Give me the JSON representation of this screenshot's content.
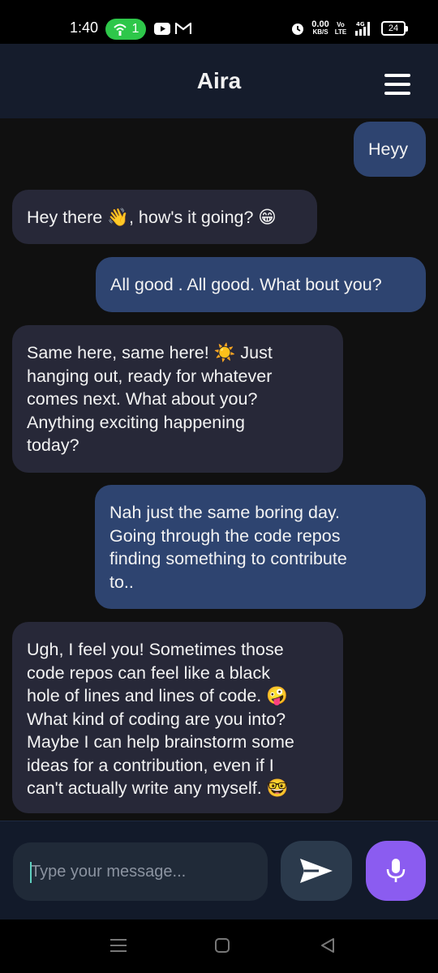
{
  "status_bar": {
    "time": "1:40",
    "hotspot_count": "1",
    "net_speed": "0.00",
    "net_speed_unit": "KB/S",
    "volte_top": "Vo",
    "volte_bottom": "LTE",
    "network_type": "4G",
    "battery": "24",
    "icons": [
      "hotspot-icon",
      "youtube-icon",
      "gmail-icon",
      "alarm-icon",
      "signal-icon",
      "battery-icon"
    ]
  },
  "header": {
    "title": "Aira",
    "menu_icon": "hamburger-menu-icon"
  },
  "messages": [
    {
      "sender": "user",
      "text": "Heyy"
    },
    {
      "sender": "bot",
      "text": "Hey there 👋, how's it going? 😁"
    },
    {
      "sender": "user",
      "text": "All good . All good. What bout you?"
    },
    {
      "sender": "bot",
      "text": "Same here, same here! ☀️ Just\nhanging out, ready for whatever\ncomes next. What about you?\nAnything exciting happening\ntoday?"
    },
    {
      "sender": "user",
      "text": "Nah just the same boring day.\nGoing through the code repos\nfinding something to contribute\nto.."
    },
    {
      "sender": "bot",
      "text": "Ugh, I feel you! Sometimes those\ncode repos can feel like a black\nhole of lines and lines of code. 🤪\nWhat kind of coding are you into?\nMaybe I can help brainstorm some\nideas for a contribution, even if I\ncan't actually write any myself. 🤓"
    }
  ],
  "input": {
    "placeholder": "Type your message...",
    "value": ""
  },
  "colors": {
    "header_bg": "#151c2c",
    "chat_bg": "#101010",
    "user_bubble": "#2e4470",
    "bot_bubble": "#272838",
    "send_button": "#2b3a4c",
    "mic_button": "#8b5cf0",
    "hotspot_pill": "#2ec74a"
  },
  "nav_bar": {
    "icons": [
      "recents-icon",
      "home-icon",
      "back-icon"
    ]
  }
}
